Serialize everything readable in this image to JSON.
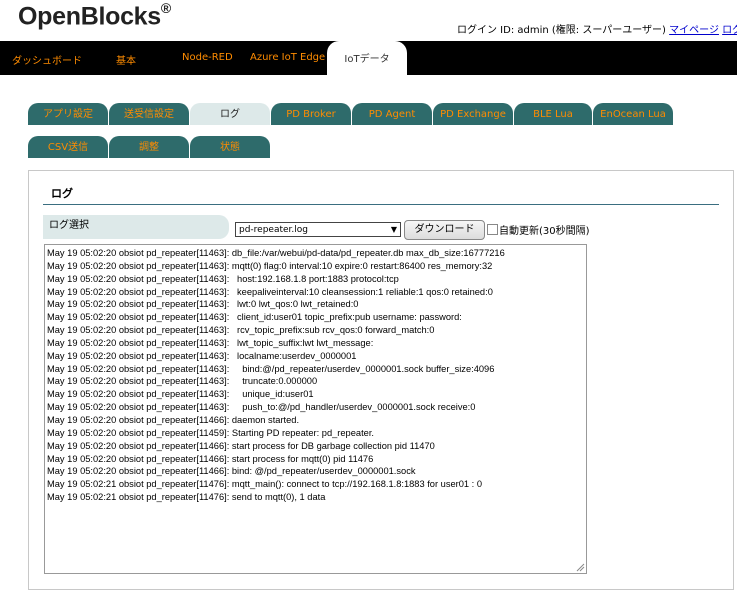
{
  "header": {
    "logo": "OpenBlocks",
    "logo_mark": "®",
    "user_info": "ログイン ID: admin (権限: スーパーユーザー)",
    "mypage_link": "マイページ",
    "logout_link": "ログ"
  },
  "topnav": {
    "tabs": [
      "ダッシュボード",
      "基本",
      "Node-RED",
      "Azure IoT Edge",
      "IoTデータ"
    ],
    "active": "IoTデータ"
  },
  "subtabs": {
    "row1": [
      "アプリ設定",
      "送受信設定",
      "ログ",
      "PD Broker",
      "PD Agent",
      "PD Exchange",
      "BLE Lua",
      "EnOcean Lua"
    ],
    "row2": [
      "CSV送信",
      "調整",
      "状態"
    ],
    "active": "ログ"
  },
  "panel": {
    "title": "ログ",
    "log_select_label": "ログ選択",
    "selected_log": "pd-repeater.log",
    "download_button": "ダウンロード",
    "auto_refresh_label": "自動更新(30秒間隔)",
    "log_lines": [
      "May 19 05:02:20 obsiot pd_repeater[11463]: db_file:/var/webui/pd-data/pd_repeater.db max_db_size:16777216",
      "May 19 05:02:20 obsiot pd_repeater[11463]: mqtt(0) flag:0 interval:10 expire:0 restart:86400 res_memory:32",
      "May 19 05:02:20 obsiot pd_repeater[11463]:   host:192.168.1.8 port:1883 protocol:tcp",
      "May 19 05:02:20 obsiot pd_repeater[11463]:   keepaliveinterval:10 cleansession:1 reliable:1 qos:0 retained:0",
      "May 19 05:02:20 obsiot pd_repeater[11463]:   lwt:0 lwt_qos:0 lwt_retained:0",
      "May 19 05:02:20 obsiot pd_repeater[11463]:   client_id:user01 topic_prefix:pub username: password:",
      "May 19 05:02:20 obsiot pd_repeater[11463]:   rcv_topic_prefix:sub rcv_qos:0 forward_match:0",
      "May 19 05:02:20 obsiot pd_repeater[11463]:   lwt_topic_suffix:lwt lwt_message:",
      "May 19 05:02:20 obsiot pd_repeater[11463]:   localname:userdev_0000001",
      "May 19 05:02:20 obsiot pd_repeater[11463]:     bind:@/pd_repeater/userdev_0000001.sock buffer_size:4096",
      "May 19 05:02:20 obsiot pd_repeater[11463]:     truncate:0.000000",
      "May 19 05:02:20 obsiot pd_repeater[11463]:     unique_id:user01",
      "May 19 05:02:20 obsiot pd_repeater[11463]:     push_to:@/pd_handler/userdev_0000001.sock receive:0",
      "May 19 05:02:20 obsiot pd_repeater[11466]: daemon started.",
      "May 19 05:02:20 obsiot pd_repeater[11459]: Starting PD repeater: pd_repeater.",
      "May 19 05:02:20 obsiot pd_repeater[11466]: start process for DB garbage collection pid 11470",
      "May 19 05:02:20 obsiot pd_repeater[11466]: start process for mqtt(0) pid 11476",
      "May 19 05:02:20 obsiot pd_repeater[11466]: bind: @/pd_repeater/userdev_0000001.sock",
      "May 19 05:02:21 obsiot pd_repeater[11476]: mqtt_main(): connect to tcp://192.168.1.8:1883 for user01 : 0",
      "May 19 05:02:21 obsiot pd_repeater[11476]: send to mqtt(0), 1 data"
    ]
  },
  "icons": {
    "dropdown": "▼",
    "resize_grip": "resize-grip-icon"
  }
}
